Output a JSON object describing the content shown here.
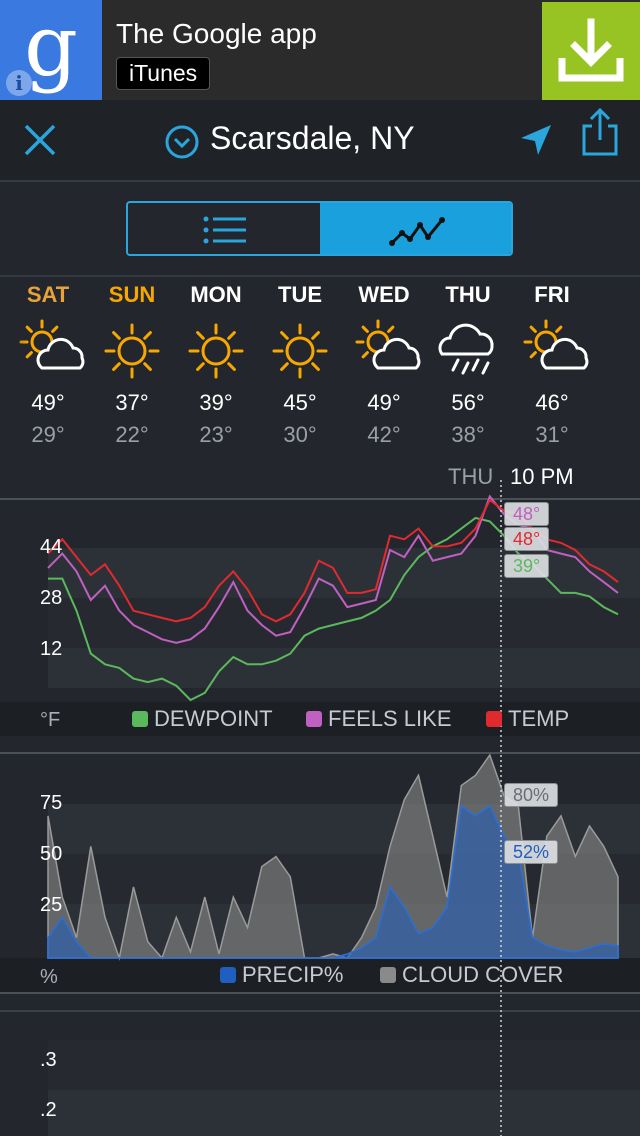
{
  "ad": {
    "logo_letter": "g",
    "title": "The Google app",
    "store": "iTunes",
    "info_glyph": "i",
    "logo_color": "#3a79e0",
    "download_color": "#98c423"
  },
  "header": {
    "city": "Scarsdale, NY",
    "accent": "#2aa6dc"
  },
  "view_toggle": {
    "active": "graph"
  },
  "days": [
    {
      "name": "SAT",
      "hi": "49°",
      "lo": "29°",
      "icon": "partly-cloudy-icon",
      "color": "#e8a23a"
    },
    {
      "name": "SUN",
      "hi": "37°",
      "lo": "22°",
      "icon": "sun-icon",
      "color": "#f7a700"
    },
    {
      "name": "MON",
      "hi": "39°",
      "lo": "23°",
      "icon": "sun-icon",
      "color": "#ffffff"
    },
    {
      "name": "TUE",
      "hi": "45°",
      "lo": "30°",
      "icon": "sun-icon",
      "color": "#ffffff"
    },
    {
      "name": "WED",
      "hi": "49°",
      "lo": "42°",
      "icon": "partly-cloudy-icon",
      "color": "#ffffff"
    },
    {
      "name": "THU",
      "hi": "56°",
      "lo": "38°",
      "icon": "rain-icon",
      "color": "#ffffff"
    },
    {
      "name": "FRI",
      "hi": "46°",
      "lo": "31°",
      "icon": "partly-cloudy-icon",
      "color": "#ffffff"
    }
  ],
  "cursor": {
    "day": "THU",
    "time": "10 PM"
  },
  "temp_chart": {
    "unit": "°F",
    "y_ticks": [
      "44",
      "28",
      "12"
    ],
    "legend": [
      {
        "label": "DEWPOINT",
        "color": "#5cb85c"
      },
      {
        "label": "FEELS LIKE",
        "color": "#c060c0"
      },
      {
        "label": "TEMP",
        "color": "#e02a30"
      }
    ],
    "tips": {
      "feels": "48°",
      "temp": "48°",
      "dew": "39°"
    }
  },
  "precip_chart": {
    "unit": "%",
    "y_ticks": [
      "75",
      "50",
      "25"
    ],
    "legend": [
      {
        "label": "PRECIP%",
        "color": "#1f5fbf"
      },
      {
        "label": "CLOUD COVER",
        "color": "#8a8a8a"
      }
    ],
    "tips": {
      "cloud": "80%",
      "precip": "52%"
    }
  },
  "amount_chart": {
    "y_ticks": [
      ".3",
      ".2"
    ]
  },
  "chart_data": [
    {
      "type": "line",
      "title": "",
      "xlabel": "",
      "ylabel": "°F",
      "ylim": [
        0,
        56
      ],
      "x": [
        "SAT",
        "SUN",
        "MON",
        "TUE",
        "WED",
        "THU",
        "FRI"
      ],
      "series": [
        {
          "name": "TEMP",
          "color": "#e02a30",
          "values": [
            41,
            45,
            40,
            35,
            38,
            32,
            25,
            24,
            23,
            22,
            23,
            26,
            32,
            36,
            31,
            24,
            22,
            24,
            30,
            39,
            37,
            30,
            30,
            31,
            46,
            45,
            48,
            43,
            43,
            44,
            48,
            56,
            53,
            52,
            48,
            45,
            44,
            42,
            38,
            36,
            33
          ]
        },
        {
          "name": "FEELS LIKE",
          "color": "#c060c0",
          "values": [
            37,
            41,
            36,
            28,
            32,
            25,
            21,
            19,
            17,
            16,
            17,
            20,
            26,
            33,
            25,
            21,
            18,
            19,
            26,
            34,
            32,
            26,
            27,
            28,
            42,
            40,
            46,
            39,
            40,
            41,
            46,
            57,
            52,
            49,
            48,
            42,
            41,
            40,
            36,
            33,
            30
          ]
        },
        {
          "name": "DEWPOINT",
          "color": "#5cb85c",
          "values": [
            34,
            34,
            25,
            13,
            10,
            9,
            6,
            5,
            6,
            4,
            0,
            2,
            8,
            12,
            10,
            10,
            11,
            13,
            18,
            20,
            21,
            22,
            23,
            25,
            28,
            35,
            40,
            43,
            45,
            48,
            51,
            50,
            46,
            41,
            38,
            34,
            30,
            30,
            29,
            26,
            24
          ]
        }
      ]
    },
    {
      "type": "area",
      "title": "",
      "xlabel": "",
      "ylabel": "%",
      "ylim": [
        0,
        100
      ],
      "x": [
        "SAT",
        "SUN",
        "MON",
        "TUE",
        "WED",
        "THU",
        "FRI"
      ],
      "series": [
        {
          "name": "CLOUD COVER",
          "color": "#8a8a8a",
          "values": [
            70,
            30,
            10,
            55,
            20,
            0,
            35,
            8,
            0,
            20,
            3,
            30,
            2,
            30,
            15,
            45,
            50,
            40,
            0,
            0,
            2,
            0,
            10,
            25,
            55,
            78,
            90,
            60,
            30,
            85,
            90,
            100,
            80,
            75,
            10,
            60,
            70,
            50,
            65,
            55,
            40
          ]
        },
        {
          "name": "PRECIP%",
          "color": "#1f5fbf",
          "values": [
            10,
            20,
            8,
            0,
            0,
            0,
            0,
            0,
            0,
            0,
            0,
            0,
            0,
            0,
            0,
            0,
            0,
            0,
            0,
            0,
            0,
            2,
            5,
            10,
            35,
            25,
            12,
            15,
            25,
            75,
            70,
            75,
            60,
            52,
            10,
            6,
            4,
            3,
            5,
            7,
            6
          ]
        }
      ]
    }
  ]
}
